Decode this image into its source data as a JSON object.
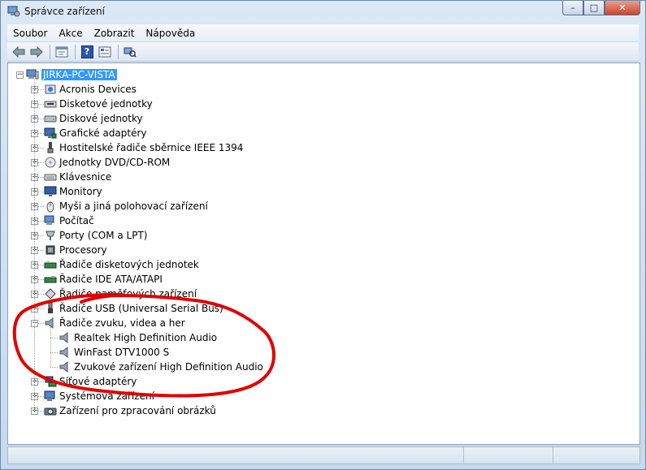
{
  "window": {
    "title": "Správce zařízení"
  },
  "window_buttons": {
    "minimize": "–",
    "maximize": "□",
    "close": "✕"
  },
  "menu": [
    "Soubor",
    "Akce",
    "Zobrazit",
    "Nápověda"
  ],
  "toolbar": {
    "back_icon": "back-arrow-icon",
    "forward_icon": "forward-arrow-icon",
    "properties_icon": "properties-icon",
    "help_icon": "help-icon",
    "help_glyph": "?",
    "scan_icon": "scan-hardware-icon"
  },
  "tree": {
    "root": "JIRKA-PC-VISTA",
    "categories": [
      {
        "label": "Acronis Devices",
        "icon": "acronis-icon",
        "expanded": false
      },
      {
        "label": "Disketové jednotky",
        "icon": "floppy-drive-icon",
        "expanded": false
      },
      {
        "label": "Diskové jednotky",
        "icon": "disk-drive-icon",
        "expanded": false
      },
      {
        "label": "Grafické adaptéry",
        "icon": "display-adapter-icon",
        "expanded": false
      },
      {
        "label": "Hostitelské řadiče sběrnice IEEE 1394",
        "icon": "ieee1394-icon",
        "expanded": false
      },
      {
        "label": "Jednotky DVD/CD-ROM",
        "icon": "dvd-drive-icon",
        "expanded": false
      },
      {
        "label": "Klávesnice",
        "icon": "keyboard-icon",
        "expanded": false
      },
      {
        "label": "Monitory",
        "icon": "monitor-icon",
        "expanded": false
      },
      {
        "label": "Myši a jiná polohovací zařízení",
        "icon": "mouse-icon",
        "expanded": false
      },
      {
        "label": "Počítač",
        "icon": "computer-icon",
        "expanded": false
      },
      {
        "label": "Porty (COM a LPT)",
        "icon": "port-icon",
        "expanded": false
      },
      {
        "label": "Procesory",
        "icon": "processor-icon",
        "expanded": false
      },
      {
        "label": "Řadiče disketových jednotek",
        "icon": "floppy-controller-icon",
        "expanded": false
      },
      {
        "label": "Řadiče IDE ATA/ATAPI",
        "icon": "ide-controller-icon",
        "expanded": false
      },
      {
        "label": "Řadiče paměťových zařízení",
        "icon": "storage-controller-icon",
        "expanded": false
      },
      {
        "label": "Řadiče USB (Universal Serial Bus)",
        "icon": "usb-icon",
        "expanded": false
      },
      {
        "label": "Řadiče zvuku, videa a her",
        "icon": "speaker-icon",
        "expanded": true,
        "children": [
          {
            "label": "Realtek High Definition Audio",
            "icon": "speaker-icon"
          },
          {
            "label": "WinFast DTV1000 S",
            "icon": "speaker-icon"
          },
          {
            "label": "Zvukové zařízení High Definition Audio",
            "icon": "speaker-icon"
          }
        ]
      },
      {
        "label": "Síťové adaptéry",
        "icon": "network-adapter-icon",
        "expanded": false
      },
      {
        "label": "Systémová zařízení",
        "icon": "system-device-icon",
        "expanded": false
      },
      {
        "label": "Zařízení pro zpracování obrázků",
        "icon": "imaging-device-icon",
        "expanded": false
      }
    ]
  },
  "colors": {
    "selection": "#3399ff",
    "annotation": "#e00000",
    "titlebar": "#c6d9ee"
  }
}
